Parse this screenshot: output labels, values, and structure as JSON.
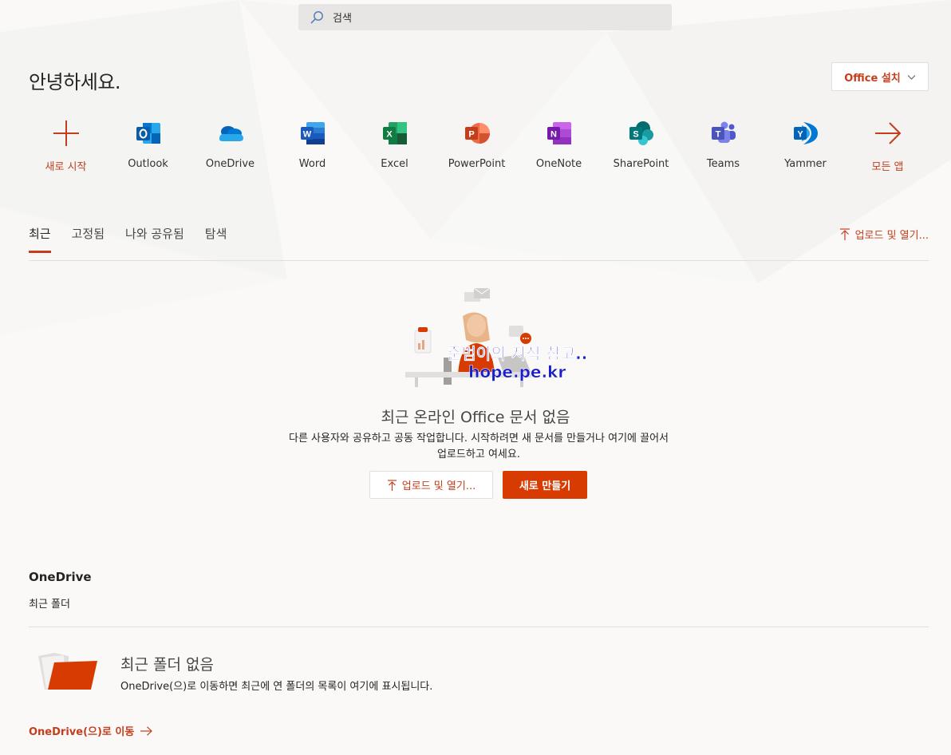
{
  "search": {
    "placeholder": "검색"
  },
  "greeting": "안녕하세요.",
  "install_office": {
    "label": "Office 설치"
  },
  "apps": [
    {
      "id": "new",
      "label": "새로 시작",
      "icon": "plus-icon"
    },
    {
      "id": "outlook",
      "label": "Outlook",
      "icon": "outlook-icon"
    },
    {
      "id": "onedrive",
      "label": "OneDrive",
      "icon": "onedrive-icon"
    },
    {
      "id": "word",
      "label": "Word",
      "icon": "word-icon"
    },
    {
      "id": "excel",
      "label": "Excel",
      "icon": "excel-icon"
    },
    {
      "id": "powerpoint",
      "label": "PowerPoint",
      "icon": "powerpoint-icon"
    },
    {
      "id": "onenote",
      "label": "OneNote",
      "icon": "onenote-icon"
    },
    {
      "id": "sharepoint",
      "label": "SharePoint",
      "icon": "sharepoint-icon"
    },
    {
      "id": "teams",
      "label": "Teams",
      "icon": "teams-icon"
    },
    {
      "id": "yammer",
      "label": "Yammer",
      "icon": "yammer-icon"
    },
    {
      "id": "all",
      "label": "모든 앱",
      "icon": "arrow-right-icon"
    }
  ],
  "tabs": [
    {
      "label": "최근",
      "active": true
    },
    {
      "label": "고정됨",
      "active": false
    },
    {
      "label": "나와 공유됨",
      "active": false
    },
    {
      "label": "탐색",
      "active": false
    }
  ],
  "upload_open": "업로드 및 열기...",
  "watermark": {
    "line1": "준범이의 지식 창고..",
    "line2": "hope.pe.kr"
  },
  "empty_state": {
    "title": "최근 온라인 Office 문서 없음",
    "desc_line1": "다른 사용자와 공유하고 공동 작업합니다. 시작하려면 새 문서를 만들거나 여기에 끌어서",
    "desc_line2": "업로드하고 여세요.",
    "upload_button": "업로드 및 열기...",
    "new_button": "새로 만들기"
  },
  "onedrive": {
    "title": "OneDrive",
    "subtitle": "최근 폴더",
    "no_folder_title": "최근 폴더 없음",
    "no_folder_desc": "OneDrive(으)로 이동하면 최근에 연 폴더의 목록이 여기에 표시됩니다.",
    "link": "OneDrive(으)로 이동"
  },
  "colors": {
    "accent": "#c43e1c",
    "primary_button": "#d83b01",
    "background": "#faf9f8"
  }
}
